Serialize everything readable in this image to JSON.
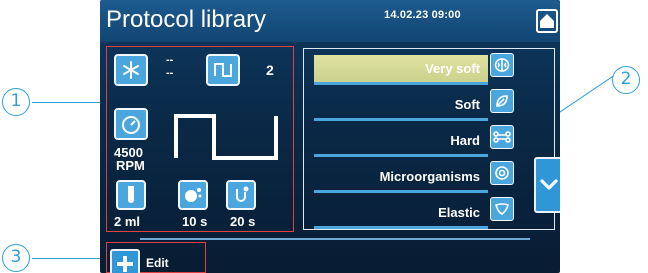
{
  "header": {
    "title": "Protocol library",
    "datetime": "14.02.23 09:00",
    "home_icon": "home-icon"
  },
  "settings_panel": {
    "cooling_icon": "snowflake-icon",
    "cooling_values": [
      "--",
      "--"
    ],
    "pulse_icon": "pulse-wave-icon",
    "pulse_count": "2",
    "speed_icon": "gauge-icon",
    "speed_value": "4500",
    "speed_unit": "RPM",
    "volume_icon": "tube-icon",
    "volume_value": "2 ml",
    "process_time_icon": "process-time-icon",
    "process_time_value": "10 s",
    "pause_time_icon": "pause-time-icon",
    "pause_time_value": "20 s"
  },
  "protocols": [
    {
      "label": "Very soft",
      "icon": "brain-icon",
      "selected": true
    },
    {
      "label": "Soft",
      "icon": "leaf-icon",
      "selected": false
    },
    {
      "label": "Hard",
      "icon": "bone-icon",
      "selected": false
    },
    {
      "label": "Microorganisms",
      "icon": "microorganism-icon",
      "selected": false
    },
    {
      "label": "Elastic",
      "icon": "liver-icon",
      "selected": false
    }
  ],
  "scroll_icon": "chevron-down-icon",
  "footer": {
    "edit_label": "Edit",
    "add_icon": "plus-icon"
  },
  "callouts": [
    "1",
    "2",
    "3"
  ],
  "colors": {
    "accent": "#4aa6dc",
    "highlight_box": "#e0403f",
    "callout": "#2f9fd8",
    "selected_row": "#d6dc98"
  }
}
